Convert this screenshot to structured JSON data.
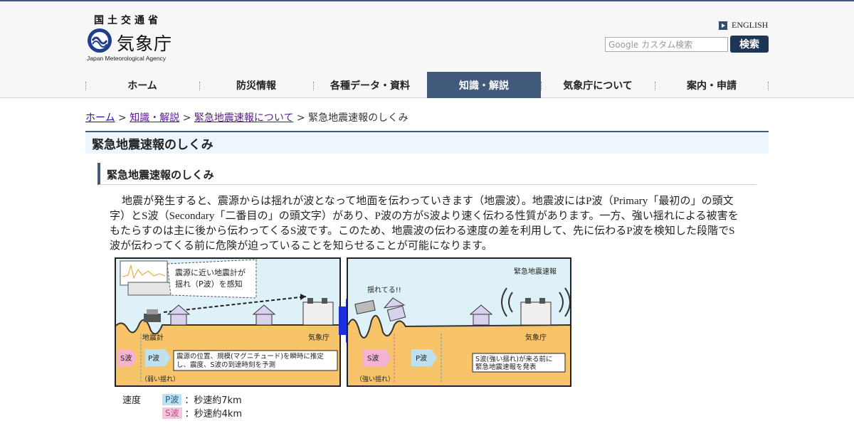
{
  "header": {
    "ministry": "国土交通省",
    "agency_name": "気象庁",
    "agency_en": "Japan Meteorological Agency",
    "english_link": "ENGLISH",
    "search_placeholder": "Google カスタム検索",
    "search_button": "検索"
  },
  "nav": [
    {
      "label": "ホーム",
      "active": false
    },
    {
      "label": "防災情報",
      "active": false
    },
    {
      "label": "各種データ・資料",
      "active": false
    },
    {
      "label": "知識・解説",
      "active": true
    },
    {
      "label": "気象庁について",
      "active": false
    },
    {
      "label": "案内・申請",
      "active": false
    }
  ],
  "breadcrumb": {
    "items": [
      "ホーム",
      "知識・解説",
      "緊急地震速報について"
    ],
    "separator": ">",
    "current": "緊急地震速報のしくみ"
  },
  "page_title": "緊急地震速報のしくみ",
  "section_heading": "緊急地震速報のしくみ",
  "body_text": "地震が発生すると、震源からは揺れが波となって地面を伝わっていきます（地震波）。地震波にはP波（Primary「最初の」の頭文字）とS波（Secondary「二番目の」の頭文字）があり、P波の方がS波より速く伝わる性質があります。一方、強い揺れによる被害をもたらすのは主に後から伝わってくるS波です。このため、地震波の伝わる速度の差を利用して、先に伝わるP波を検知した段階でS波が伝わってくる前に危険が迫っていることを知らせることが可能になります。",
  "figure": {
    "left": {
      "callout": [
        "震源に近い地震計が",
        "揺れ（P波）を感知"
      ],
      "seismometer": "地震計",
      "jma": "気象庁",
      "s_wave": "S波",
      "p_wave": "P波",
      "note": [
        "震源の位置、規模(マグニチュード)を瞬時に推定",
        "し、震度、S波の到達時刻を予測"
      ],
      "shake": "（弱い揺れ）"
    },
    "right": {
      "broadcast": "緊急地震速報",
      "shaking": "揺れてる!!",
      "jma": "気象庁",
      "s_wave": "S波",
      "p_wave": "P波",
      "note": [
        "S波(強い揺れ)が来る前に",
        "緊急地震速報を発表"
      ],
      "shake": "（強い揺れ）"
    }
  },
  "speed": {
    "label": "速度",
    "p": {
      "chip": "P波",
      "text": "：秒速約7km"
    },
    "s": {
      "chip": "S波",
      "text": "：秒速約4km"
    }
  },
  "colors": {
    "nav_active": "#41597a",
    "sky": "#dff1f8",
    "ground": "#f8c46a",
    "link": "#1a0dab"
  }
}
